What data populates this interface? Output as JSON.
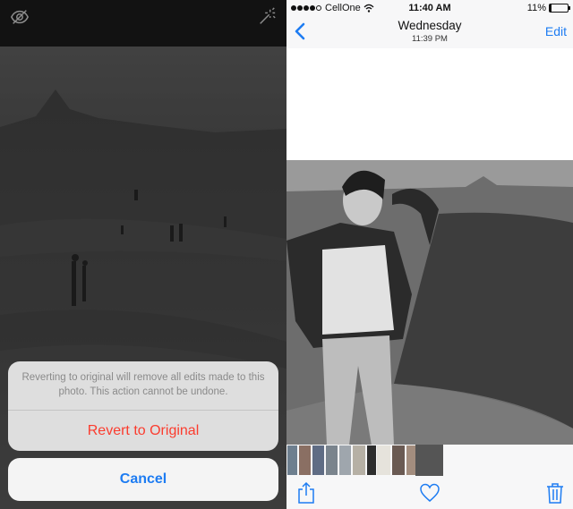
{
  "left": {
    "action_sheet": {
      "message": "Reverting to original will remove all edits made to this photo. This action cannot be undone.",
      "revert_label": "Revert to Original",
      "cancel_label": "Cancel"
    },
    "icons": {
      "top_left": "eye-icon",
      "top_right": "magic-wand-icon"
    }
  },
  "status_bar": {
    "carrier": "CellOne",
    "time": "11:40 AM",
    "battery": "11%",
    "battery_level": 0.11
  },
  "nav": {
    "title": "Wednesday",
    "subtitle": "11:39 PM",
    "edit_label": "Edit"
  },
  "toolbar": {
    "icons": [
      "share-icon",
      "heart-icon",
      "trash-icon"
    ]
  },
  "colors": {
    "accent": "#1d7cf2",
    "destructive": "#fb3c2e"
  }
}
